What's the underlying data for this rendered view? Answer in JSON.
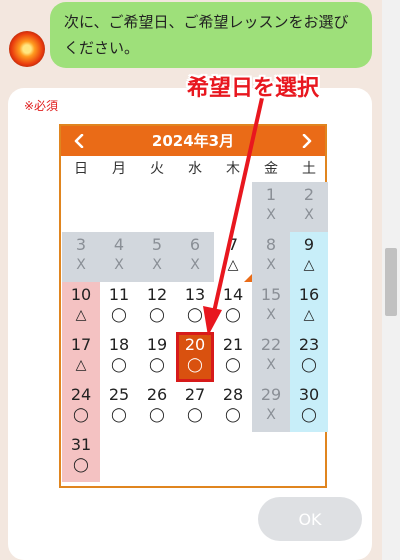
{
  "chat": {
    "message": "次に、ご希望日、ご希望レッスンをお選びください。"
  },
  "form": {
    "required_label": "※必須",
    "ok_label": "OK"
  },
  "calendar": {
    "title": "2024年3月",
    "prev_icon": "chevron-left-icon",
    "next_icon": "chevron-right-icon",
    "weekdays": [
      "日",
      "月",
      "火",
      "水",
      "木",
      "金",
      "土"
    ],
    "selected_day": "20",
    "accent_color": "#ea6b17",
    "days": [
      {
        "day": "1",
        "mark": "X",
        "status": "closed"
      },
      {
        "day": "2",
        "mark": "X",
        "status": "closed"
      },
      {
        "day": "3",
        "mark": "X",
        "status": "closed"
      },
      {
        "day": "4",
        "mark": "X",
        "status": "closed"
      },
      {
        "day": "5",
        "mark": "X",
        "status": "closed"
      },
      {
        "day": "6",
        "mark": "X",
        "status": "closed"
      },
      {
        "day": "7",
        "mark": "△",
        "status": "open"
      },
      {
        "day": "8",
        "mark": "X",
        "status": "closed"
      },
      {
        "day": "9",
        "mark": "△",
        "status": "open"
      },
      {
        "day": "10",
        "mark": "△",
        "status": "open"
      },
      {
        "day": "11",
        "mark": "◯",
        "status": "open"
      },
      {
        "day": "12",
        "mark": "◯",
        "status": "open"
      },
      {
        "day": "13",
        "mark": "◯",
        "status": "open"
      },
      {
        "day": "14",
        "mark": "◯",
        "status": "open"
      },
      {
        "day": "15",
        "mark": "X",
        "status": "closed"
      },
      {
        "day": "16",
        "mark": "△",
        "status": "open"
      },
      {
        "day": "17",
        "mark": "△",
        "status": "open"
      },
      {
        "day": "18",
        "mark": "◯",
        "status": "open"
      },
      {
        "day": "19",
        "mark": "◯",
        "status": "open"
      },
      {
        "day": "20",
        "mark": "◯",
        "status": "open"
      },
      {
        "day": "21",
        "mark": "◯",
        "status": "open"
      },
      {
        "day": "22",
        "mark": "X",
        "status": "closed"
      },
      {
        "day": "23",
        "mark": "◯",
        "status": "open"
      },
      {
        "day": "24",
        "mark": "◯",
        "status": "open"
      },
      {
        "day": "25",
        "mark": "◯",
        "status": "open"
      },
      {
        "day": "26",
        "mark": "◯",
        "status": "open"
      },
      {
        "day": "27",
        "mark": "◯",
        "status": "open"
      },
      {
        "day": "28",
        "mark": "◯",
        "status": "open"
      },
      {
        "day": "29",
        "mark": "X",
        "status": "closed"
      },
      {
        "day": "30",
        "mark": "◯",
        "status": "open"
      },
      {
        "day": "31",
        "mark": "◯",
        "status": "open"
      }
    ]
  },
  "annotation": {
    "label": "希望日を選択",
    "color": "#e8171f"
  }
}
